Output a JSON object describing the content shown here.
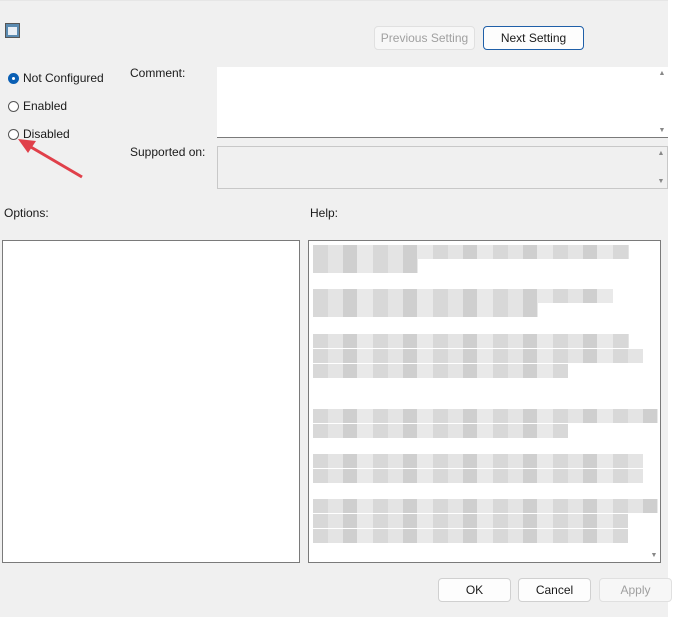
{
  "nav": {
    "previous_label": "Previous Setting",
    "next_label": "Next Setting"
  },
  "state": {
    "options": [
      {
        "label": "Not Configured",
        "selected": true
      },
      {
        "label": "Enabled",
        "selected": false
      },
      {
        "label": "Disabled",
        "selected": false
      }
    ]
  },
  "labels": {
    "comment": "Comment:",
    "supported_on": "Supported on:",
    "options": "Options:",
    "help": "Help:"
  },
  "comment_value": "",
  "supported_value": "",
  "footer": {
    "ok": "OK",
    "cancel": "Cancel",
    "apply": "Apply"
  },
  "colors": {
    "accent": "#0a5fb4",
    "annotation_arrow": "#e0404a"
  }
}
